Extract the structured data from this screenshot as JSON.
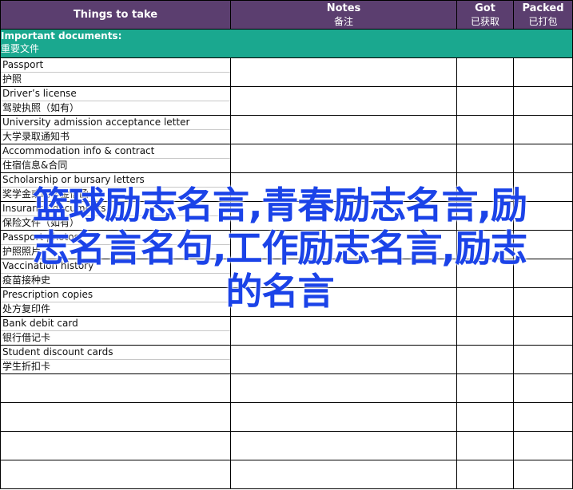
{
  "header": {
    "things": "Things to take",
    "notes": "Notes",
    "notes_zh": "备注",
    "got": "Got",
    "got_zh": "已获取",
    "packed": "Packed",
    "packed_zh": "已打包"
  },
  "section": {
    "title": "Important documents:",
    "title_zh": "重要文件"
  },
  "items": [
    {
      "en": "Passport",
      "zh": "护照"
    },
    {
      "en": "Driver’s license",
      "zh": "驾驶执照（如有）"
    },
    {
      "en": "University admission acceptance letter",
      "zh": "大学录取通知书"
    },
    {
      "en": "Accommodation info & contract",
      "zh": "住宿信息&合同"
    },
    {
      "en": "Scholarship or bursary letters",
      "zh": "奖学金或助学金信函"
    },
    {
      "en": "Insurance documents",
      "zh": "保险文件（如有）"
    },
    {
      "en": "Passport photos",
      "zh": "护照照片"
    },
    {
      "en": "Vaccination history",
      "zh": "疫苗接种史"
    },
    {
      "en": "Prescription copies",
      "zh": "处方复印件"
    },
    {
      "en": "Bank debit card",
      "zh": "银行借记卡"
    },
    {
      "en": "Student discount cards",
      "zh": "学生折扣卡"
    }
  ],
  "overlay_text": "篮球励志名言,青春励志名言,励志名言名句,工作励志名言,励志的名言",
  "colors": {
    "header_bg": "#5b3e6f",
    "section_bg": "#1aa88f",
    "overlay_text": "#1b43e8"
  }
}
